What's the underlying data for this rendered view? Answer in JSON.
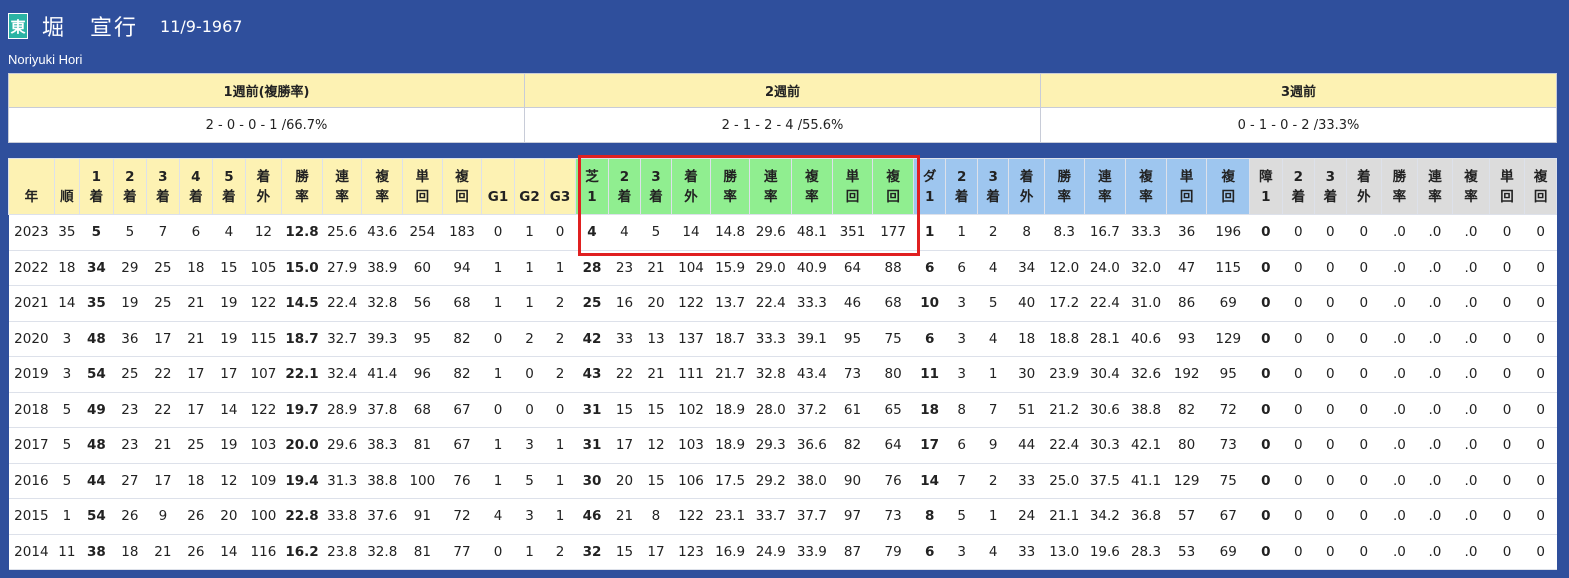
{
  "header": {
    "badge": "東",
    "name_jp": "堀　宣行",
    "birthdate": "11/9-1967",
    "name_en": "Noriyuki Hori"
  },
  "weeks": {
    "headers": [
      "1週前(複勝率)",
      "2週前",
      "3週前"
    ],
    "values": [
      "2 - 0 - 0 - 1 /66.7%",
      "2 - 1 - 2 - 4 /55.6%",
      "0 - 1 - 0 - 2 /33.3%"
    ]
  },
  "columns": [
    {
      "top": "",
      "bottom": "年",
      "group": "y"
    },
    {
      "top": "",
      "bottom": "順",
      "group": "y"
    },
    {
      "top": "1",
      "bottom": "着",
      "group": "y"
    },
    {
      "top": "2",
      "bottom": "着",
      "group": "y"
    },
    {
      "top": "3",
      "bottom": "着",
      "group": "y"
    },
    {
      "top": "4",
      "bottom": "着",
      "group": "y"
    },
    {
      "top": "5",
      "bottom": "着",
      "group": "y"
    },
    {
      "top": "着",
      "bottom": "外",
      "group": "y"
    },
    {
      "top": "勝",
      "bottom": "率",
      "group": "y"
    },
    {
      "top": "連",
      "bottom": "率",
      "group": "y"
    },
    {
      "top": "複",
      "bottom": "率",
      "group": "y"
    },
    {
      "top": "単",
      "bottom": "回",
      "group": "y"
    },
    {
      "top": "複",
      "bottom": "回",
      "group": "y"
    },
    {
      "top": "",
      "bottom": "G1",
      "group": "y"
    },
    {
      "top": "",
      "bottom": "G2",
      "group": "y"
    },
    {
      "top": "",
      "bottom": "G3",
      "group": "y"
    },
    {
      "top": "芝",
      "bottom": "1",
      "group": "g"
    },
    {
      "top": "2",
      "bottom": "着",
      "group": "g"
    },
    {
      "top": "3",
      "bottom": "着",
      "group": "g"
    },
    {
      "top": "着",
      "bottom": "外",
      "group": "g"
    },
    {
      "top": "勝",
      "bottom": "率",
      "group": "g"
    },
    {
      "top": "連",
      "bottom": "率",
      "group": "g"
    },
    {
      "top": "複",
      "bottom": "率",
      "group": "g"
    },
    {
      "top": "単",
      "bottom": "回",
      "group": "g"
    },
    {
      "top": "複",
      "bottom": "回",
      "group": "g"
    },
    {
      "top": "ダ",
      "bottom": "1",
      "group": "b"
    },
    {
      "top": "2",
      "bottom": "着",
      "group": "b"
    },
    {
      "top": "3",
      "bottom": "着",
      "group": "b"
    },
    {
      "top": "着",
      "bottom": "外",
      "group": "b"
    },
    {
      "top": "勝",
      "bottom": "率",
      "group": "b"
    },
    {
      "top": "連",
      "bottom": "率",
      "group": "b"
    },
    {
      "top": "複",
      "bottom": "率",
      "group": "b"
    },
    {
      "top": "単",
      "bottom": "回",
      "group": "b"
    },
    {
      "top": "複",
      "bottom": "回",
      "group": "b"
    },
    {
      "top": "障",
      "bottom": "1",
      "group": "s"
    },
    {
      "top": "2",
      "bottom": "着",
      "group": "s"
    },
    {
      "top": "3",
      "bottom": "着",
      "group": "s"
    },
    {
      "top": "着",
      "bottom": "外",
      "group": "s"
    },
    {
      "top": "勝",
      "bottom": "率",
      "group": "s"
    },
    {
      "top": "連",
      "bottom": "率",
      "group": "s"
    },
    {
      "top": "複",
      "bottom": "率",
      "group": "s"
    },
    {
      "top": "単",
      "bottom": "回",
      "group": "s"
    },
    {
      "top": "複",
      "bottom": "回",
      "group": "s"
    }
  ],
  "bold_columns": [
    2,
    8,
    16,
    25,
    34
  ],
  "rows": [
    [
      "2023",
      "35",
      "5",
      "5",
      "7",
      "6",
      "4",
      "12",
      "12.8",
      "25.6",
      "43.6",
      "254",
      "183",
      "0",
      "1",
      "0",
      "4",
      "4",
      "5",
      "14",
      "14.8",
      "29.6",
      "48.1",
      "351",
      "177",
      "1",
      "1",
      "2",
      "8",
      "8.3",
      "16.7",
      "33.3",
      "36",
      "196",
      "0",
      "0",
      "0",
      "0",
      ".0",
      ".0",
      ".0",
      "0",
      "0"
    ],
    [
      "2022",
      "18",
      "34",
      "29",
      "25",
      "18",
      "15",
      "105",
      "15.0",
      "27.9",
      "38.9",
      "60",
      "94",
      "1",
      "1",
      "1",
      "28",
      "23",
      "21",
      "104",
      "15.9",
      "29.0",
      "40.9",
      "64",
      "88",
      "6",
      "6",
      "4",
      "34",
      "12.0",
      "24.0",
      "32.0",
      "47",
      "115",
      "0",
      "0",
      "0",
      "0",
      ".0",
      ".0",
      ".0",
      "0",
      "0"
    ],
    [
      "2021",
      "14",
      "35",
      "19",
      "25",
      "21",
      "19",
      "122",
      "14.5",
      "22.4",
      "32.8",
      "56",
      "68",
      "1",
      "1",
      "2",
      "25",
      "16",
      "20",
      "122",
      "13.7",
      "22.4",
      "33.3",
      "46",
      "68",
      "10",
      "3",
      "5",
      "40",
      "17.2",
      "22.4",
      "31.0",
      "86",
      "69",
      "0",
      "0",
      "0",
      "0",
      ".0",
      ".0",
      ".0",
      "0",
      "0"
    ],
    [
      "2020",
      "3",
      "48",
      "36",
      "17",
      "21",
      "19",
      "115",
      "18.7",
      "32.7",
      "39.3",
      "95",
      "82",
      "0",
      "2",
      "2",
      "42",
      "33",
      "13",
      "137",
      "18.7",
      "33.3",
      "39.1",
      "95",
      "75",
      "6",
      "3",
      "4",
      "18",
      "18.8",
      "28.1",
      "40.6",
      "93",
      "129",
      "0",
      "0",
      "0",
      "0",
      ".0",
      ".0",
      ".0",
      "0",
      "0"
    ],
    [
      "2019",
      "3",
      "54",
      "25",
      "22",
      "17",
      "17",
      "107",
      "22.1",
      "32.4",
      "41.4",
      "96",
      "82",
      "1",
      "0",
      "2",
      "43",
      "22",
      "21",
      "111",
      "21.7",
      "32.8",
      "43.4",
      "73",
      "80",
      "11",
      "3",
      "1",
      "30",
      "23.9",
      "30.4",
      "32.6",
      "192",
      "95",
      "0",
      "0",
      "0",
      "0",
      ".0",
      ".0",
      ".0",
      "0",
      "0"
    ],
    [
      "2018",
      "5",
      "49",
      "23",
      "22",
      "17",
      "14",
      "122",
      "19.7",
      "28.9",
      "37.8",
      "68",
      "67",
      "0",
      "0",
      "0",
      "31",
      "15",
      "15",
      "102",
      "18.9",
      "28.0",
      "37.2",
      "61",
      "65",
      "18",
      "8",
      "7",
      "51",
      "21.2",
      "30.6",
      "38.8",
      "82",
      "72",
      "0",
      "0",
      "0",
      "0",
      ".0",
      ".0",
      ".0",
      "0",
      "0"
    ],
    [
      "2017",
      "5",
      "48",
      "23",
      "21",
      "25",
      "19",
      "103",
      "20.0",
      "29.6",
      "38.3",
      "81",
      "67",
      "1",
      "3",
      "1",
      "31",
      "17",
      "12",
      "103",
      "18.9",
      "29.3",
      "36.6",
      "82",
      "64",
      "17",
      "6",
      "9",
      "44",
      "22.4",
      "30.3",
      "42.1",
      "80",
      "73",
      "0",
      "0",
      "0",
      "0",
      ".0",
      ".0",
      ".0",
      "0",
      "0"
    ],
    [
      "2016",
      "5",
      "44",
      "27",
      "17",
      "18",
      "12",
      "109",
      "19.4",
      "31.3",
      "38.8",
      "100",
      "76",
      "1",
      "5",
      "1",
      "30",
      "20",
      "15",
      "106",
      "17.5",
      "29.2",
      "38.0",
      "90",
      "76",
      "14",
      "7",
      "2",
      "33",
      "25.0",
      "37.5",
      "41.1",
      "129",
      "75",
      "0",
      "0",
      "0",
      "0",
      ".0",
      ".0",
      ".0",
      "0",
      "0"
    ],
    [
      "2015",
      "1",
      "54",
      "26",
      "9",
      "26",
      "20",
      "100",
      "22.8",
      "33.8",
      "37.6",
      "91",
      "72",
      "4",
      "3",
      "1",
      "46",
      "21",
      "8",
      "122",
      "23.1",
      "33.7",
      "37.7",
      "97",
      "73",
      "8",
      "5",
      "1",
      "24",
      "21.1",
      "34.2",
      "36.8",
      "57",
      "67",
      "0",
      "0",
      "0",
      "0",
      ".0",
      ".0",
      ".0",
      "0",
      "0"
    ],
    [
      "2014",
      "11",
      "38",
      "18",
      "21",
      "26",
      "14",
      "116",
      "16.2",
      "23.8",
      "32.8",
      "81",
      "77",
      "0",
      "1",
      "2",
      "32",
      "15",
      "17",
      "123",
      "16.9",
      "24.9",
      "33.9",
      "87",
      "79",
      "6",
      "3",
      "4",
      "33",
      "13.0",
      "19.6",
      "28.3",
      "53",
      "69",
      "0",
      "0",
      "0",
      "0",
      ".0",
      ".0",
      ".0",
      "0",
      "0"
    ]
  ]
}
